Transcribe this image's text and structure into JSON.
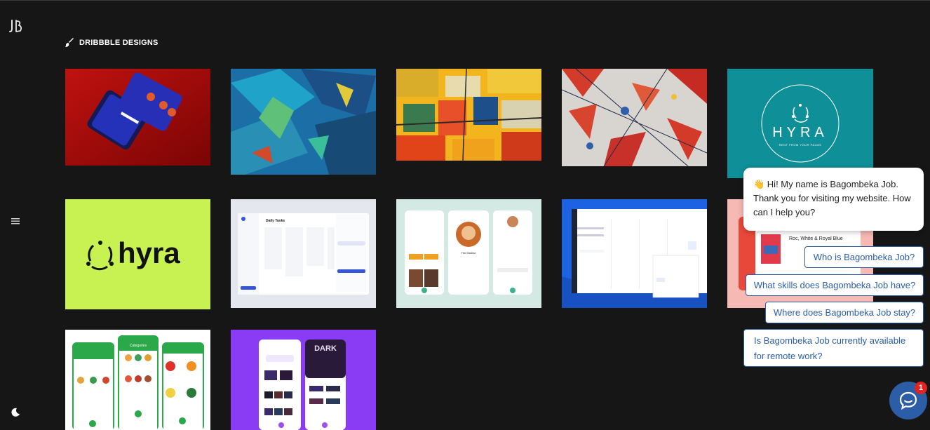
{
  "brand": {
    "logo_text": "JB"
  },
  "section": {
    "title": "DRIBBBLE DESIGNS",
    "icon": "paintbrush-icon"
  },
  "tiles": [
    {
      "name": "tile-mobile-app-red",
      "colors": [
        "#b30f0f",
        "#2a2d9a"
      ]
    },
    {
      "name": "tile-blue-abstract-paint",
      "colors": [
        "#1d7fb8",
        "#1a3f6b"
      ]
    },
    {
      "name": "tile-yellow-abstract-paint",
      "colors": [
        "#f1b71a",
        "#d24a14"
      ]
    },
    {
      "name": "tile-red-white-abstract-paint",
      "colors": [
        "#d9d3cc",
        "#d43a2a"
      ]
    },
    {
      "name": "tile-hyra-teal-logo",
      "text": "HYRA",
      "subtext": "RENT FROM YOUR PALMS",
      "colors": [
        "#0f8f97"
      ]
    },
    {
      "name": "tile-hyra-lime-logo",
      "text": "hyra",
      "colors": [
        "#c7f252"
      ]
    },
    {
      "name": "tile-daily-tasks-dashboard",
      "text": "Daily Tasks",
      "colors": [
        "#e7e9ee"
      ]
    },
    {
      "name": "tile-movie-app",
      "text": "The Martian",
      "colors": [
        "#cfe5df"
      ]
    },
    {
      "name": "tile-calendar-dashboard",
      "colors": [
        "#1e62e4"
      ]
    },
    {
      "name": "tile-book-app",
      "text": "Roc, White & Royal Blue",
      "colors": [
        "#f6b7b2"
      ]
    },
    {
      "name": "tile-grocery-app",
      "text": "Categories",
      "colors": [
        "#ffffff",
        "#27a84a"
      ]
    },
    {
      "name": "tile-dark-movie-app",
      "text": "DARK",
      "colors": [
        "#8a3cf5"
      ]
    }
  ],
  "chat": {
    "greeting": "👋 Hi! My name is Bagombeka Job. Thank you for visiting my website. How can I help you?",
    "quick_replies": [
      "Who is Bagombeka Job?",
      "What skills does Bagombeka Job have?",
      "Where does Bagombeka Job stay?",
      "Is Bagombeka Job currently available for remote work?"
    ],
    "unread_count": "1",
    "accent": "#2b5ea7"
  }
}
